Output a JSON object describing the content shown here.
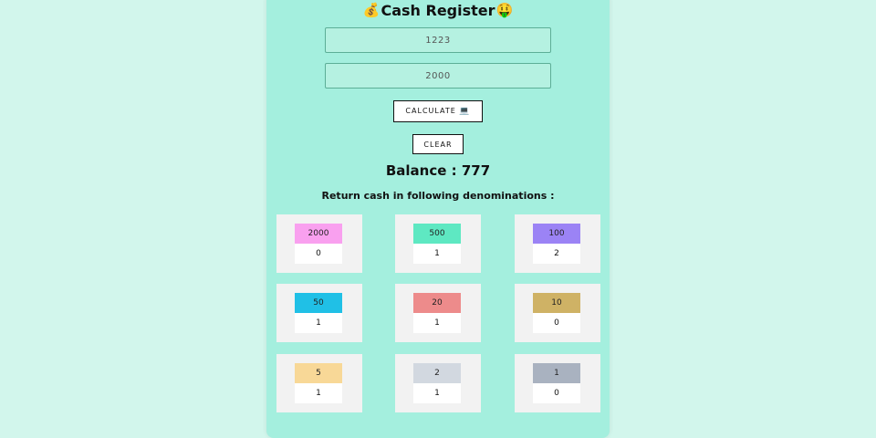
{
  "app": {
    "title": "Cash Register",
    "title_left_icon": "money-bag-icon",
    "title_right_icon": "money-mouth-face-icon"
  },
  "inputs": {
    "bill_amount": "1223",
    "cash_given": "2000"
  },
  "buttons": {
    "calculate_label": "CALCULATE",
    "calculate_icon": "laptop-icon",
    "clear_label": "CLEAR"
  },
  "result": {
    "balance_text": "Balance : 777",
    "denominations_heading": "Return cash in following denominations :"
  },
  "colors": {
    "background": "#d2f6ec",
    "panel": "#a4efde",
    "card": "#f2f2f2"
  },
  "denominations": [
    {
      "note": "2000",
      "count": "0",
      "color": "#f9a0ef"
    },
    {
      "note": "500",
      "count": "1",
      "color": "#5ee8c2"
    },
    {
      "note": "100",
      "count": "2",
      "color": "#9b83f5"
    },
    {
      "note": "50",
      "count": "1",
      "color": "#20c0e6"
    },
    {
      "note": "20",
      "count": "1",
      "color": "#ed8b8b"
    },
    {
      "note": "10",
      "count": "0",
      "color": "#cfb265"
    },
    {
      "note": "5",
      "count": "1",
      "color": "#f8d897"
    },
    {
      "note": "2",
      "count": "1",
      "color": "#d2d8e0"
    },
    {
      "note": "1",
      "count": "0",
      "color": "#a9b2c0"
    }
  ]
}
